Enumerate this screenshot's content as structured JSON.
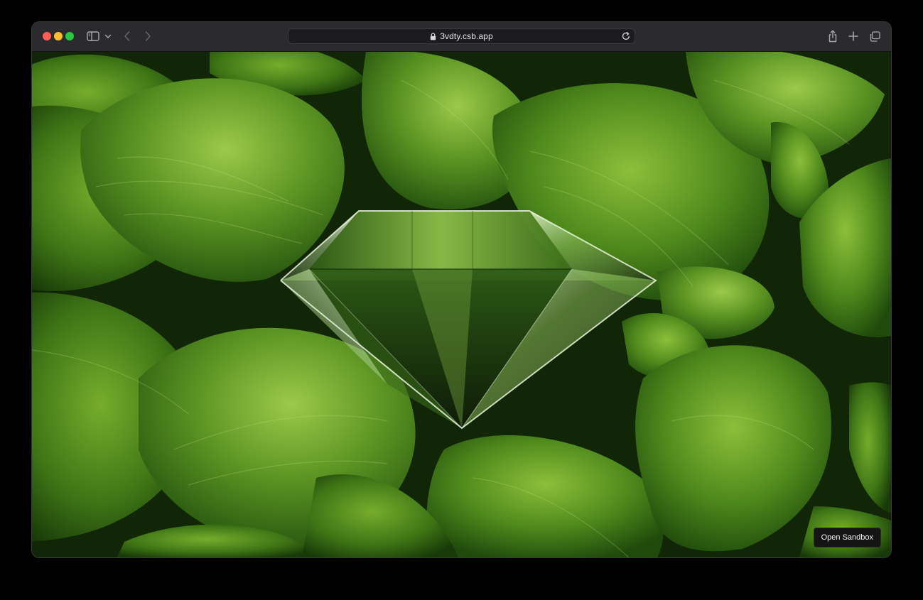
{
  "browser": {
    "url": "3vdty.csb.app",
    "icons": {
      "sidebar": "sidebar-icon",
      "tab_menu": "chevron-down-icon",
      "back": "chevron-left-icon",
      "forward": "chevron-right-icon",
      "lock": "lock-icon",
      "reload": "reload-icon",
      "share": "share-icon",
      "new_tab": "plus-icon",
      "tab_overview": "tabs-icon"
    },
    "traffic_lights": {
      "close": "#ff5f57",
      "minimize": "#febc2e",
      "zoom": "#28c840"
    }
  },
  "page": {
    "open_sandbox_label": "Open Sandbox",
    "background": "green hosta leaves photo",
    "centerpiece": "glass diamond refraction"
  }
}
